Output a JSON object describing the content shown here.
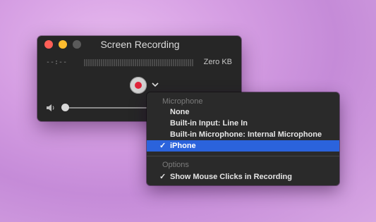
{
  "window": {
    "title": "Screen Recording",
    "time": "--:--",
    "size": "Zero KB"
  },
  "menu": {
    "microphone_header": "Microphone",
    "items": [
      {
        "label": "None",
        "checked": false
      },
      {
        "label": "Built-in Input: Line In",
        "checked": false
      },
      {
        "label": "Built-in Microphone: Internal Microphone",
        "checked": false
      },
      {
        "label": "iPhone",
        "checked": true,
        "check": "✓"
      }
    ],
    "options_header": "Options",
    "option_item": {
      "label": "Show Mouse Clicks in Recording",
      "checked": true,
      "check": "✓"
    }
  },
  "colors": {
    "record": "#e0243a",
    "selection": "#2b63dc",
    "close": "#ff5f57",
    "minimize": "#febc2e"
  }
}
